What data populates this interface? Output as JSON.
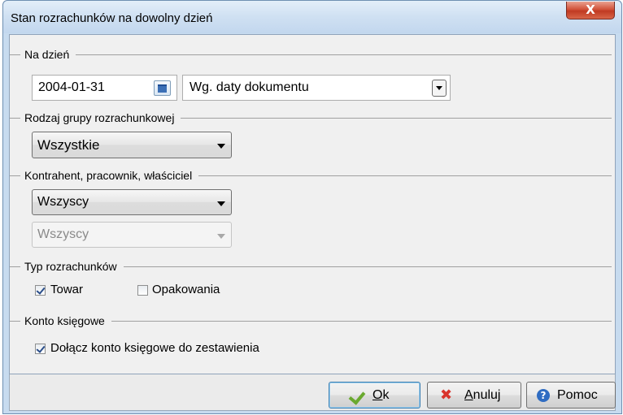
{
  "window": {
    "title": "Stan rozrachunków na dowolny dzień",
    "close_glyph": "X"
  },
  "na_dzien": {
    "label": "Na dzień",
    "date_value": "2004-01-31",
    "calendar_icon": "calendar-icon",
    "date_mode_value": "Wg. daty dokumentu"
  },
  "rodzaj_grupy": {
    "label": "Rodzaj grupy rozrachunkowej",
    "value": "Wszystkie"
  },
  "kontrahent": {
    "label": "Kontrahent, pracownik, właściciel",
    "value_primary": "Wszyscy",
    "value_secondary": "Wszyscy"
  },
  "typ_rozrachunkow": {
    "label": "Typ rozrachunków",
    "towar": {
      "label": "Towar",
      "checked": true
    },
    "opakowania": {
      "label": "Opakowania",
      "checked": false
    }
  },
  "konto_ksiegowe": {
    "label": "Konto księgowe",
    "dolacz": {
      "label": "Dołącz konto księgowe do zestawienia",
      "checked": true
    }
  },
  "buttons": {
    "ok": {
      "mnemonic": "O",
      "rest": "k"
    },
    "anuluj": {
      "mnemonic": "A",
      "rest": "nuluj"
    },
    "pomoc": {
      "label": "Pomoc"
    }
  },
  "icons": {
    "help_glyph": "?",
    "cancel_glyph": "✖"
  },
  "colors": {
    "accent": "#3c7fb1",
    "ok_check": "#6aa92f",
    "cancel_x": "#d9342b",
    "help": "#2f6cc2"
  }
}
